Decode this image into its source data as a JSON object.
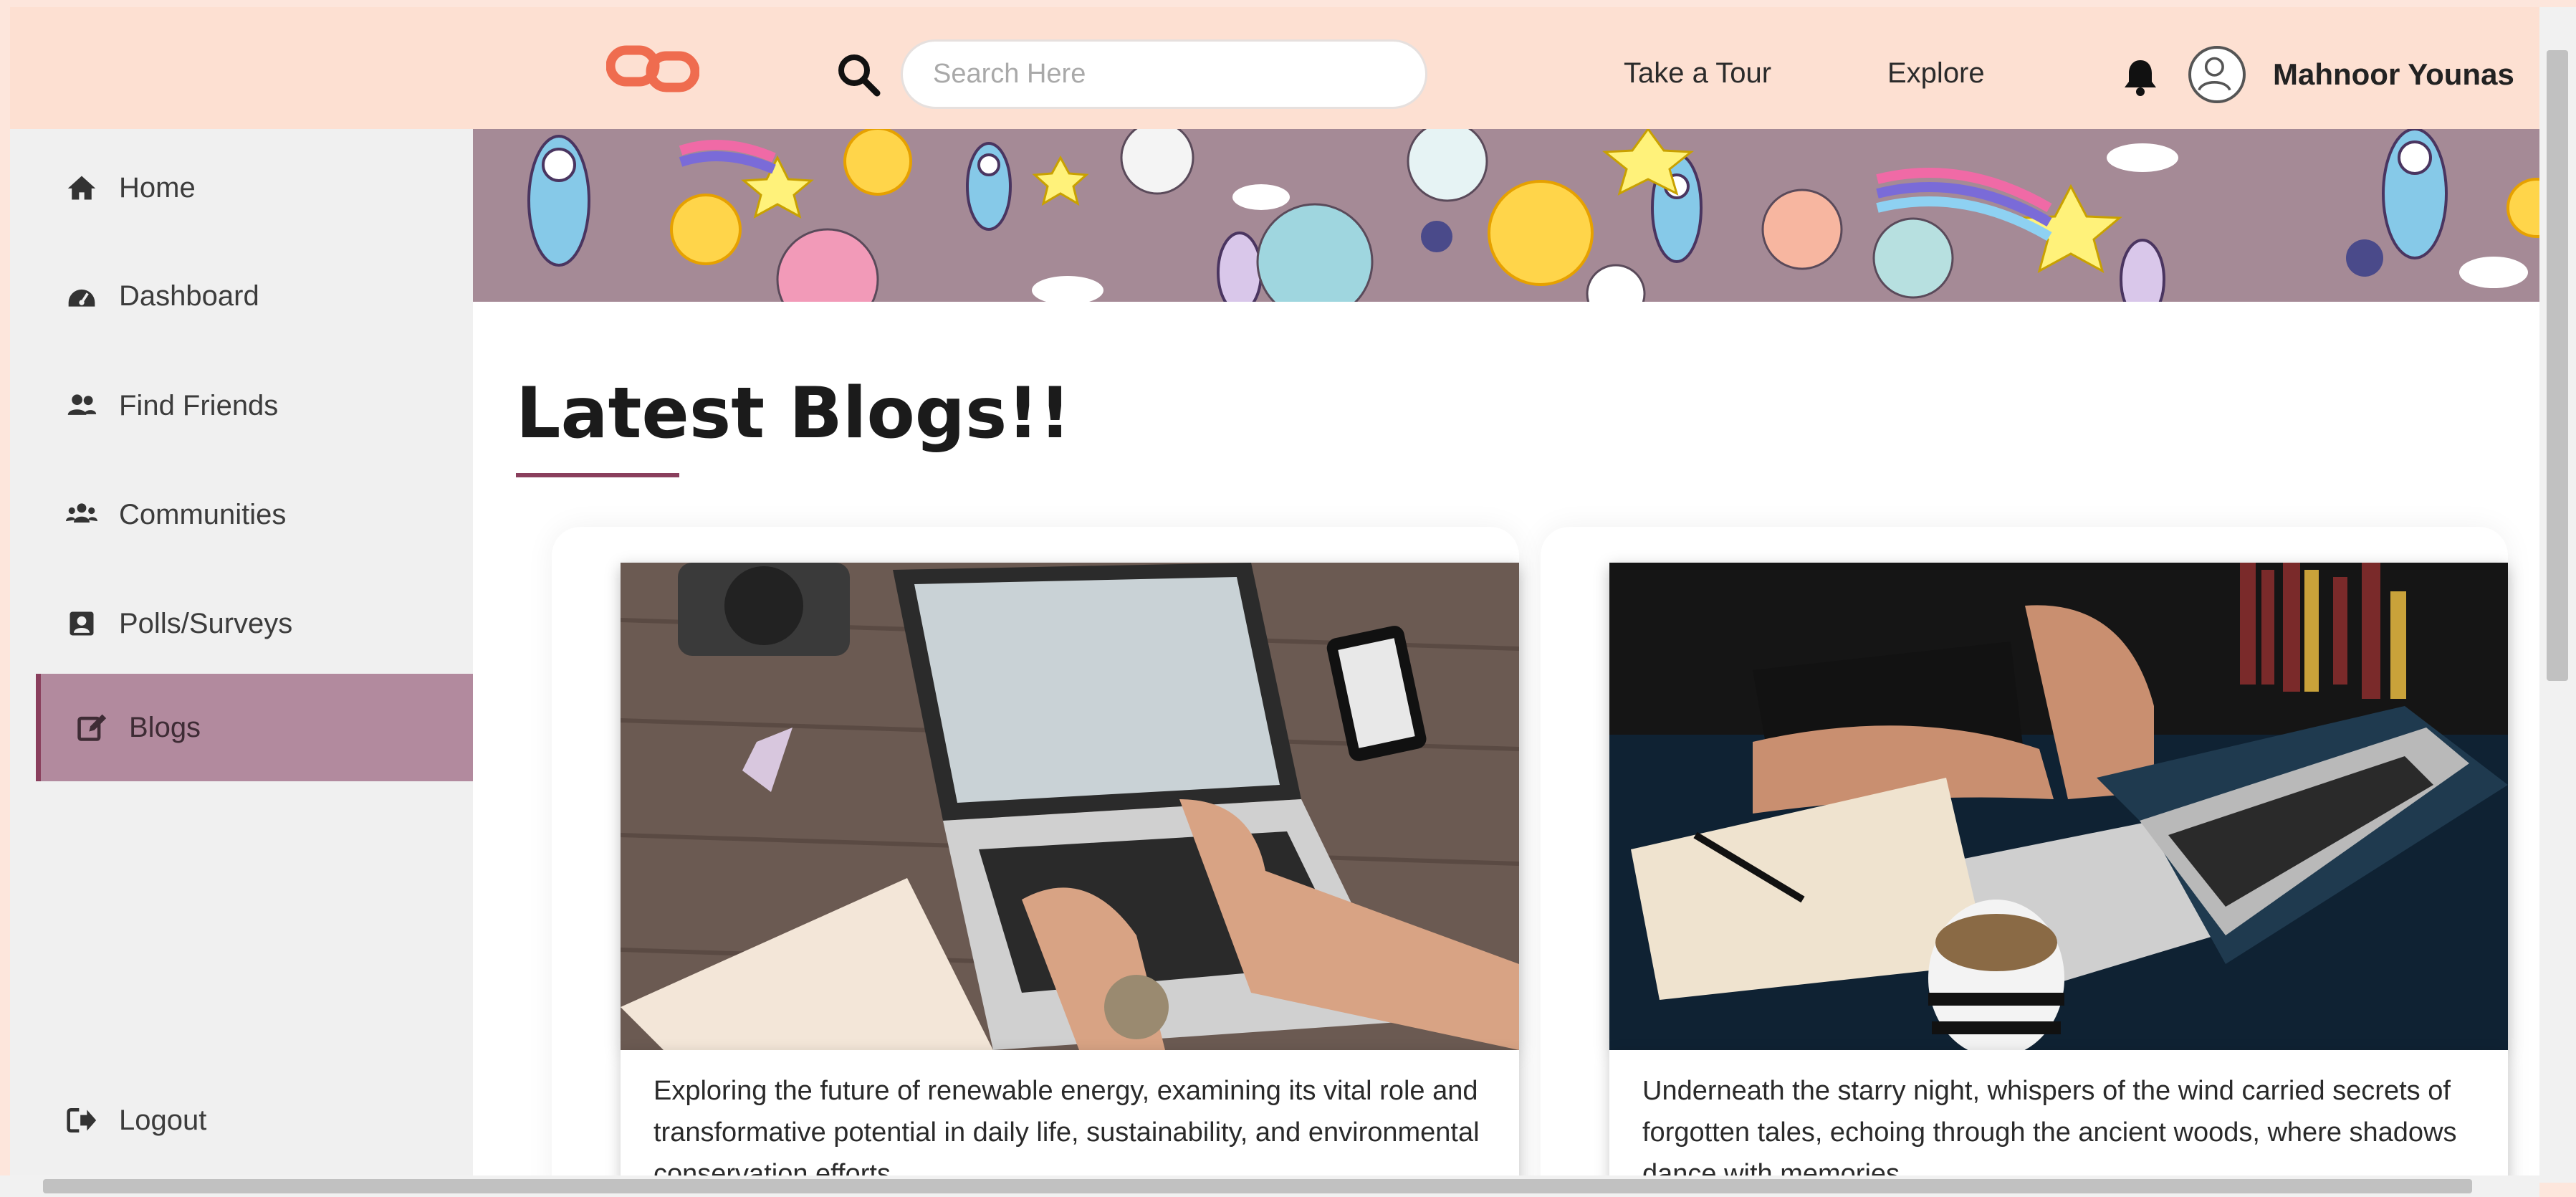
{
  "header": {
    "logo_icon": "link-logo",
    "search": {
      "icon": "search-icon",
      "placeholder": "Search Here",
      "value": ""
    },
    "nav": {
      "tour_label": "Take a Tour",
      "explore_label": "Explore"
    },
    "notification_icon": "bell-icon",
    "avatar_icon": "user-avatar-icon",
    "user_name": "Mahnoor Younas"
  },
  "sidebar": {
    "items": [
      {
        "label": "Home",
        "icon": "home-icon"
      },
      {
        "label": "Dashboard",
        "icon": "dashboard-icon"
      },
      {
        "label": "Find Friends",
        "icon": "friends-icon"
      },
      {
        "label": "Communities",
        "icon": "communities-icon"
      },
      {
        "label": "Polls/Surveys",
        "icon": "poll-icon"
      },
      {
        "label": "Blogs",
        "icon": "edit-icon",
        "active": true
      }
    ],
    "logout_label": "Logout",
    "logout_icon": "logout-icon"
  },
  "main": {
    "title": "Latest Blogs!!",
    "blogs": [
      {
        "image": "laptop-wooden-desk-photo",
        "excerpt": "Exploring the future of renewable energy, examining its vital role and transformative potential in daily life, sustainability, and environmental conservation efforts."
      },
      {
        "image": "laptop-dark-desk-photo",
        "excerpt": "Underneath the starry night, whispers of the wind carried secrets of forgotten tales, echoing through the ancient woods, where shadows dance with memories."
      }
    ]
  },
  "colors": {
    "header_bg": "#fde0d2",
    "accent": "#8a3f5d",
    "active_item_bg": "#b28a9e",
    "logo": "#ef6c4f"
  }
}
